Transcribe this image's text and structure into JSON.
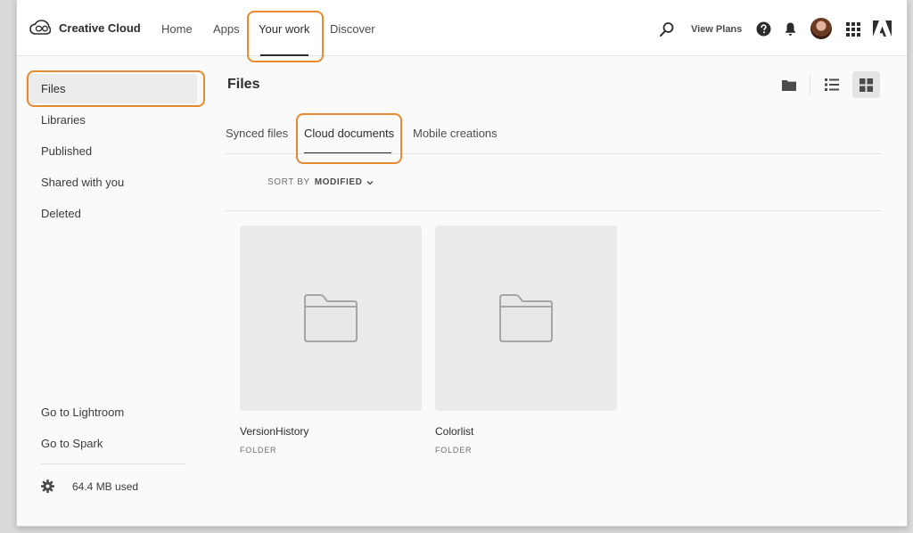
{
  "header": {
    "brand": "Creative Cloud",
    "nav": [
      {
        "label": "Home"
      },
      {
        "label": "Apps"
      },
      {
        "label": "Your work"
      },
      {
        "label": "Discover"
      }
    ],
    "view_plans": "View Plans",
    "icons": [
      "creative-cloud-logo-icon",
      "search-icon",
      "help-icon",
      "bell-icon",
      "avatar",
      "app-grid-icon",
      "adobe-logo-icon"
    ]
  },
  "sidebar": {
    "items": [
      {
        "label": "Files"
      },
      {
        "label": "Libraries"
      },
      {
        "label": "Published"
      },
      {
        "label": "Shared with you"
      },
      {
        "label": "Deleted"
      }
    ],
    "footer_links": [
      {
        "label": "Go to Lightroom"
      },
      {
        "label": "Go to Spark"
      }
    ],
    "storage": "64.4 MB used"
  },
  "main": {
    "title": "Files",
    "tabs": [
      {
        "label": "Synced files"
      },
      {
        "label": "Cloud documents"
      },
      {
        "label": "Mobile creations"
      }
    ],
    "sort": {
      "label": "SORT BY",
      "value": "MODIFIED"
    },
    "items": [
      {
        "name": "VersionHistory",
        "type": "FOLDER"
      },
      {
        "name": "Colorlist",
        "type": "FOLDER"
      }
    ]
  },
  "colors": {
    "highlight": "#e98a2e",
    "selected_bg": "#ececec",
    "folder": "#a6a6a6"
  }
}
